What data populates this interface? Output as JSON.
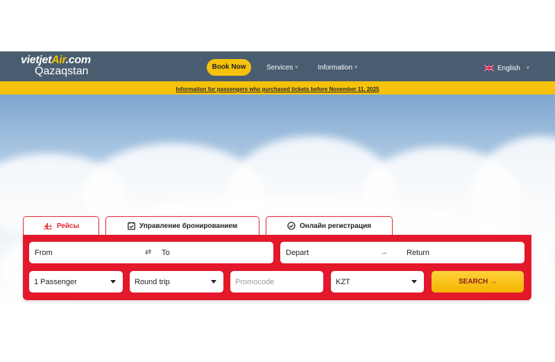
{
  "brand": {
    "logo_text": "vietjetAir.com",
    "logo_text_main": "vietjet",
    "logo_text_air": "Air",
    "logo_text_tail": ".com",
    "region": "Qazaqstan",
    "header_color": "#4a5d70",
    "accent_yellow": "#f5c20c",
    "accent_red": "#e3182b"
  },
  "nav": {
    "book_now": "Book Now",
    "services": "Services",
    "information": "Information",
    "chevron_icon": "chevron-down-icon",
    "language": "English",
    "language_flag_icon": "uk-flag-icon"
  },
  "notice": {
    "text": "Information for passengers who purchased tickets before November 11, 2025"
  },
  "tabs": [
    {
      "label": "Рейсы",
      "icon": "airplane-icon",
      "active": true
    },
    {
      "label": "Управление бронированием",
      "icon": "calendar-check-icon",
      "active": false
    },
    {
      "label": "Онлайн регистрация",
      "icon": "check-circle-icon",
      "active": false
    }
  ],
  "search": {
    "from_placeholder": "From",
    "swap_icon": "⇄",
    "to_placeholder": "To",
    "depart_placeholder": "Depart",
    "date_arrow_icon": "→",
    "return_placeholder": "Return",
    "passengers_value": "1 Passenger",
    "trip_type_value": "Round trip",
    "promocode_placeholder": "Promocode",
    "currency_value": "KZT",
    "search_button": "SEARCH →"
  }
}
